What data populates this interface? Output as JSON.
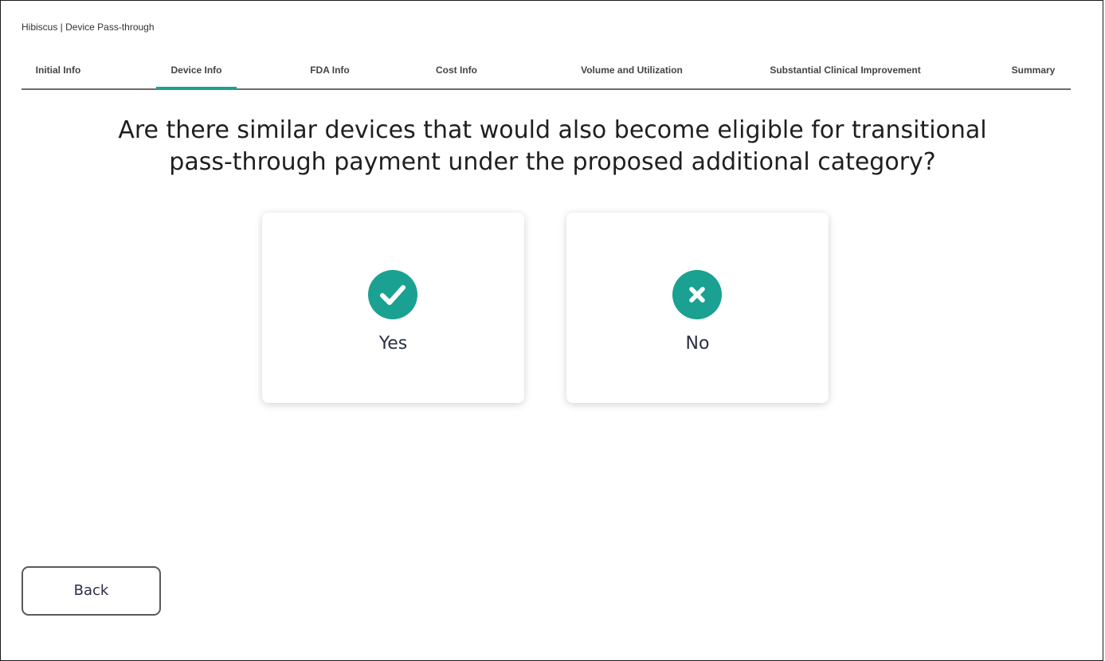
{
  "header": {
    "app_title": "Hibiscus | Device Pass-through"
  },
  "tabs": [
    {
      "label": "Initial Info",
      "active": false
    },
    {
      "label": "Device Info",
      "active": true
    },
    {
      "label": "FDA Info",
      "active": false
    },
    {
      "label": "Cost Info",
      "active": false
    },
    {
      "label": "Volume and Utilization",
      "active": false
    },
    {
      "label": "Substantial Clinical Improvement",
      "active": false
    },
    {
      "label": "Summary",
      "active": false
    }
  ],
  "question": {
    "line1": "Are there similar devices that would also become eligible for transitional",
    "line2": "pass-through payment under the proposed additional category?"
  },
  "options": {
    "yes": {
      "label": "Yes",
      "icon": "check-circle-icon"
    },
    "no": {
      "label": "No",
      "icon": "x-circle-icon"
    }
  },
  "footer": {
    "back_label": "Back"
  },
  "colors": {
    "accent": "#1aa191",
    "text_dark": "#2a2f45",
    "tab_underline": "#6b6b6b"
  }
}
